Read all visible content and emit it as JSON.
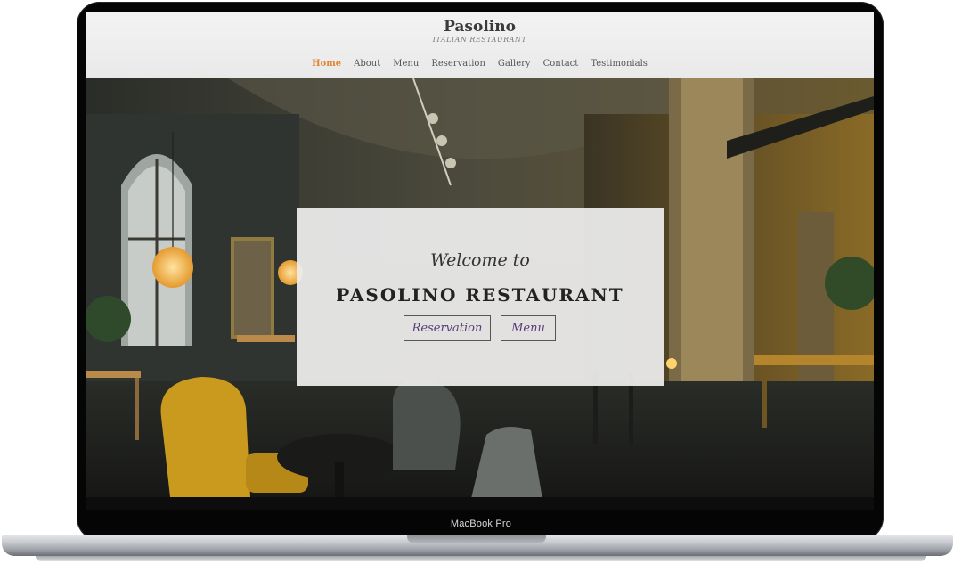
{
  "device": {
    "label": "MacBook Pro"
  },
  "site": {
    "brand_name": "Pasolino",
    "brand_tagline": "ITALIAN RESTAURANT",
    "nav": [
      "Home",
      "About",
      "Menu",
      "Reservation",
      "Gallery",
      "Contact",
      "Testimonials"
    ],
    "active_nav": "Home"
  },
  "hero": {
    "welcome": "Welcome to",
    "title": "PASOLINO RESTAURANT",
    "buttons": {
      "reservation": "Reservation",
      "menu": "Menu"
    }
  },
  "colors": {
    "accent": "#e0842f",
    "button_text": "#5a3d78",
    "header_bg": "#f0f0f0",
    "lamp": "#f4b34a",
    "armchair": "#c99a1e"
  }
}
